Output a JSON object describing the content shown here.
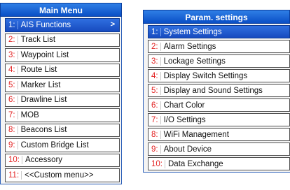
{
  "main_menu": {
    "title": "Main Menu",
    "items": [
      {
        "num": "1:",
        "label": "AIS Functions",
        "selected": true,
        "submenu": ">"
      },
      {
        "num": "2:",
        "label": "Track List"
      },
      {
        "num": "3:",
        "label": "Waypoint List"
      },
      {
        "num": "4:",
        "label": "Route List"
      },
      {
        "num": "5:",
        "label": "Marker List"
      },
      {
        "num": "6:",
        "label": "Drawline List"
      },
      {
        "num": "7:",
        "label": "MOB"
      },
      {
        "num": "8:",
        "label": "Beacons List"
      },
      {
        "num": "9:",
        "label": "Custom Bridge List"
      },
      {
        "num": "10:",
        "label": "Accessory"
      },
      {
        "num": "11:",
        "label": "<<Custom menu>>"
      }
    ]
  },
  "param_settings": {
    "title": "Param. settings",
    "items": [
      {
        "num": "1:",
        "label": "System Settings",
        "selected": true
      },
      {
        "num": "2:",
        "label": "Alarm Settings"
      },
      {
        "num": "3:",
        "label": "Lockage Settings"
      },
      {
        "num": "4:",
        "label": "Display Switch Settings"
      },
      {
        "num": "5:",
        "label": "Display and Sound Settings"
      },
      {
        "num": "6:",
        "label": "Chart Color"
      },
      {
        "num": "7:",
        "label": "I/O Settings"
      },
      {
        "num": "8:",
        "label": "WiFi Management"
      },
      {
        "num": "9:",
        "label": "About Device"
      },
      {
        "num": "10:",
        "label": "Data Exchange"
      }
    ]
  },
  "colors": {
    "title_bar": "#0a4fc6",
    "selected_item": "#174bbf",
    "number": "#e32222"
  }
}
